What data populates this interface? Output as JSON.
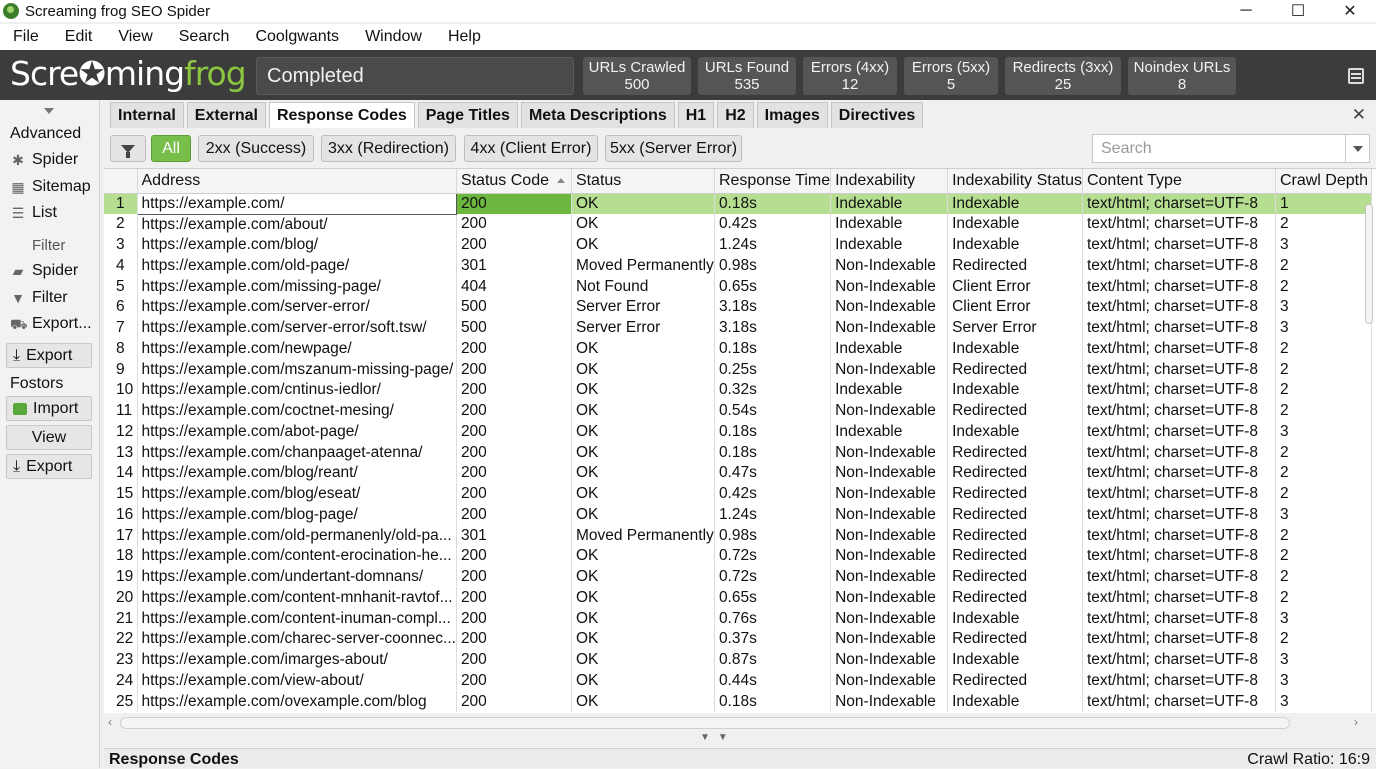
{
  "window": {
    "title": "Screaming frog SEO Spider",
    "controls": [
      "─",
      "☐",
      "✕"
    ]
  },
  "menu": [
    "File",
    "Edit",
    "View",
    "Search",
    "Coolgwants",
    "Window",
    "Help"
  ],
  "header": {
    "logo_white": "Scre",
    "logo_green_mid": "✪",
    "logo_white2": "ming",
    "logo_green": "frog",
    "status": "Completed",
    "stats": [
      {
        "label": "URLs Crawled",
        "value": "500"
      },
      {
        "label": "URLs Found",
        "value": "535"
      },
      {
        "label": "Errors (4xx)",
        "value": "12"
      },
      {
        "label": "Errors (5xx)",
        "value": "5"
      },
      {
        "label": "Redirects (3xx)",
        "value": "25"
      },
      {
        "label": "Noindex URLs",
        "value": "8"
      }
    ]
  },
  "sidebar": {
    "advanced": "Advanced",
    "spider": "Spider",
    "sitemap": "Sitemap",
    "list": "List",
    "filter_heading": "Filter",
    "spider2": "Spider",
    "filter": "Filter",
    "export_menu": "Export...",
    "export_btn": "Export",
    "fostors": "Fostors",
    "import_btn": "Import",
    "view_btn": "View",
    "export_btn2": "Export"
  },
  "tabs": [
    "Internal",
    "External",
    "Response Codes",
    "Page Titles",
    "Meta Descriptions",
    "H1",
    "H2",
    "Images",
    "Directives"
  ],
  "filters": [
    "All",
    "2xx (Success)",
    "3xx (Redirection)",
    "4xx (Client Error)",
    "5xx (Server Error)"
  ],
  "search": {
    "placeholder": "Search"
  },
  "columns": [
    "Address",
    "Status Code",
    "Status",
    "Response Time",
    "Indexability",
    "Indexability Status",
    "Content Type",
    "Crawl Depth"
  ],
  "rows": [
    [
      "1",
      "https://example.com/",
      "200",
      "OK",
      "0.18s",
      "Indexable",
      "Indexable",
      "text/html; charset=UTF-8",
      "1"
    ],
    [
      "2",
      "https://example.com/about/",
      "200",
      "OK",
      "0.42s",
      "Indexable",
      "Indexable",
      "text/html; charset=UTF-8",
      "2"
    ],
    [
      "3",
      "https://example.com/blog/",
      "200",
      "OK",
      "1.24s",
      "Indexable",
      "Indexable",
      "text/html; charset=UTF-8",
      "3"
    ],
    [
      "4",
      "https://example.com/old-page/",
      "301",
      "Moved Permanently",
      "0.98s",
      "Non-Indexable",
      "Redirected",
      "text/html; charset=UTF-8",
      "2"
    ],
    [
      "5",
      "https://example.com/missing-page/",
      "404",
      "Not Found",
      "0.65s",
      "Non-Indexable",
      "Client Error",
      "text/html; charset=UTF-8",
      "2"
    ],
    [
      "6",
      "https://example.com/server-error/",
      "500",
      "Server Error",
      "3.18s",
      "Non-Indexable",
      "Client Error",
      "text/html; charset=UTF-8",
      "3"
    ],
    [
      "7",
      "https://example.com/server-error/soft.tsw/",
      "500",
      "Server Error",
      "3.18s",
      "Non-Indexable",
      "Server Error",
      "text/html; charset=UTF-8",
      "3"
    ],
    [
      "8",
      "https://example.com/newpage/",
      "200",
      "OK",
      "0.18s",
      "Indexable",
      "Indexable",
      "text/html; charset=UTF-8",
      "2"
    ],
    [
      "9",
      "https://example.com/mszanum-missing-page/",
      "200",
      "OK",
      "0.25s",
      "Non-Indexable",
      "Redirected",
      "text/html; charset=UTF-8",
      "2"
    ],
    [
      "10",
      "https://example.com/cntinus-iedlor/",
      "200",
      "OK",
      "0.32s",
      "Indexable",
      "Indexable",
      "text/html; charset=UTF-8",
      "2"
    ],
    [
      "11",
      "https://example.com/coctnet-mesing/",
      "200",
      "OK",
      "0.54s",
      "Non-Indexable",
      "Redirected",
      "text/html; charset=UTF-8",
      "2"
    ],
    [
      "12",
      "https://example.com/abot-page/",
      "200",
      "OK",
      "0.18s",
      "Indexable",
      "Indexable",
      "text/html; charset=UTF-8",
      "3"
    ],
    [
      "13",
      "https://example.com/chanpaaget-atenna/",
      "200",
      "OK",
      "0.18s",
      "Non-Indexable",
      "Redirected",
      "text/html; charset=UTF-8",
      "2"
    ],
    [
      "14",
      "https://example.com/blog/reant/",
      "200",
      "OK",
      "0.47s",
      "Non-Indexable",
      "Redirected",
      "text/html; charset=UTF-8",
      "2"
    ],
    [
      "15",
      "https://example.com/blog/eseat/",
      "200",
      "OK",
      "0.42s",
      "Non-Indexable",
      "Redirected",
      "text/html; charset=UTF-8",
      "2"
    ],
    [
      "16",
      "https://example.com/blog-page/",
      "200",
      "OK",
      "1.24s",
      "Non-Indexable",
      "Redirected",
      "text/html; charset=UTF-8",
      "3"
    ],
    [
      "17",
      "https://example.com/old-permanenly/old-pa...",
      "301",
      "Moved Permanently",
      "0.98s",
      "Non-Indexable",
      "Redirected",
      "text/html; charset=UTF-8",
      "2"
    ],
    [
      "18",
      "https://example.com/content-erocination-he...",
      "200",
      "OK",
      "0.72s",
      "Non-Indexable",
      "Redirected",
      "text/html; charset=UTF-8",
      "2"
    ],
    [
      "19",
      "https://example.com/undertant-domnans/",
      "200",
      "OK",
      "0.72s",
      "Non-Indexable",
      "Redirected",
      "text/html; charset=UTF-8",
      "2"
    ],
    [
      "20",
      "https://example.com/content-mnhanit-ravtof...",
      "200",
      "OK",
      "0.65s",
      "Non-Indexable",
      "Redirected",
      "text/html; charset=UTF-8",
      "2"
    ],
    [
      "21",
      "https://example.com/content-inuman-compl...",
      "200",
      "OK",
      "0.76s",
      "Non-Indexable",
      "Indexable",
      "text/html; charset=UTF-8",
      "3"
    ],
    [
      "22",
      "https://example.com/charec-server-coonnec...",
      "200",
      "OK",
      "0.37s",
      "Non-Indexable",
      "Redirected",
      "text/html; charset=UTF-8",
      "2"
    ],
    [
      "23",
      "https://example.com/imarges-about/",
      "200",
      "OK",
      "0.87s",
      "Non-Indexable",
      "Indexable",
      "text/html; charset=UTF-8",
      "3"
    ],
    [
      "24",
      "https://example.com/view-about/",
      "200",
      "OK",
      "0.44s",
      "Non-Indexable",
      "Redirected",
      "text/html; charset=UTF-8",
      "3"
    ],
    [
      "25",
      "https://example.com/ovexample.com/blog",
      "200",
      "OK",
      "0.18s",
      "Non-Indexable",
      "Indexable",
      "text/html; charset=UTF-8",
      "3"
    ]
  ],
  "bottom": {
    "left": "Response Codes",
    "right": "Crawl Ratio: 16:9"
  },
  "colors": {
    "accent": "#78be4a",
    "header_bg": "#3c3c3c",
    "selected_row": "#b6de90"
  }
}
